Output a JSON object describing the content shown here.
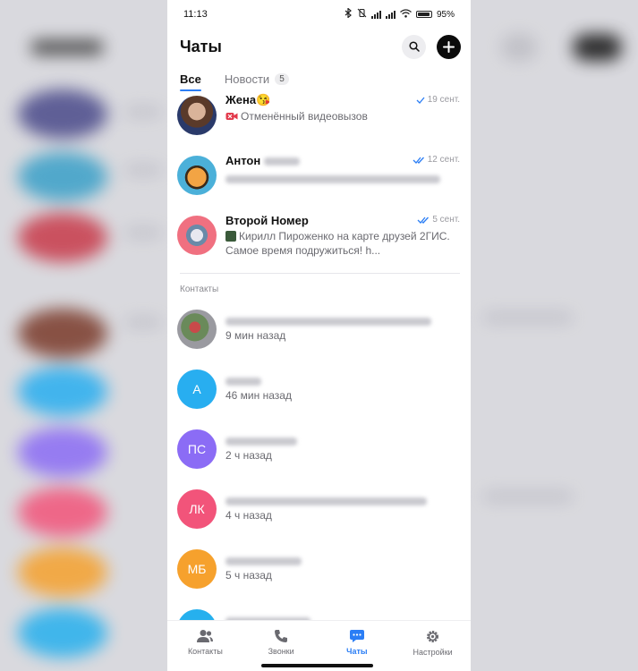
{
  "status_bar": {
    "time": "11:13",
    "battery": "95"
  },
  "header": {
    "title": "Чаты",
    "search_icon": "search-icon",
    "new_chat_icon": "plus-icon"
  },
  "tabs": [
    {
      "label": "Все",
      "active": true
    },
    {
      "label": "Новости",
      "badge": "5"
    }
  ],
  "chats": [
    {
      "name": "Жена😘",
      "time": "19 сент.",
      "message": "Отменённый видеовызов",
      "read": "single-check"
    },
    {
      "name": "Антон",
      "time": "12 сент.",
      "message": "",
      "read": "double-check"
    },
    {
      "name": "Второй Номер",
      "time": "5 сент.",
      "message_line1": "Кирилл Пироженко на карте друзей 2ГИС.",
      "message_line2": "Самое время подружиться! h...",
      "read": "double-check"
    }
  ],
  "contacts_section": {
    "title": "Контакты",
    "items": [
      {
        "initials": "",
        "seen": "9 мин назад",
        "color": "#b5494a"
      },
      {
        "initials": "А",
        "seen": "46 мин назад",
        "color": "#28aef0"
      },
      {
        "initials": "ПС",
        "seen": "2 ч назад",
        "color": "#8b6cf5"
      },
      {
        "initials": "ЛК",
        "seen": "4 ч назад",
        "color": "#f2547a"
      },
      {
        "initials": "МБ",
        "seen": "5 ч назад",
        "color": "#f6a12d"
      },
      {
        "initials": "",
        "seen": "",
        "color": "#26b0ee"
      }
    ]
  },
  "bottom_nav": [
    {
      "label": "Контакты",
      "icon": "contacts-icon"
    },
    {
      "label": "Звонки",
      "icon": "phone-icon"
    },
    {
      "label": "Чаты",
      "icon": "chat-icon",
      "active": true
    },
    {
      "label": "Настройки",
      "icon": "gear-icon"
    }
  ],
  "colors": {
    "accent": "#2b7ef5",
    "background_blur": "#d9d9de"
  }
}
